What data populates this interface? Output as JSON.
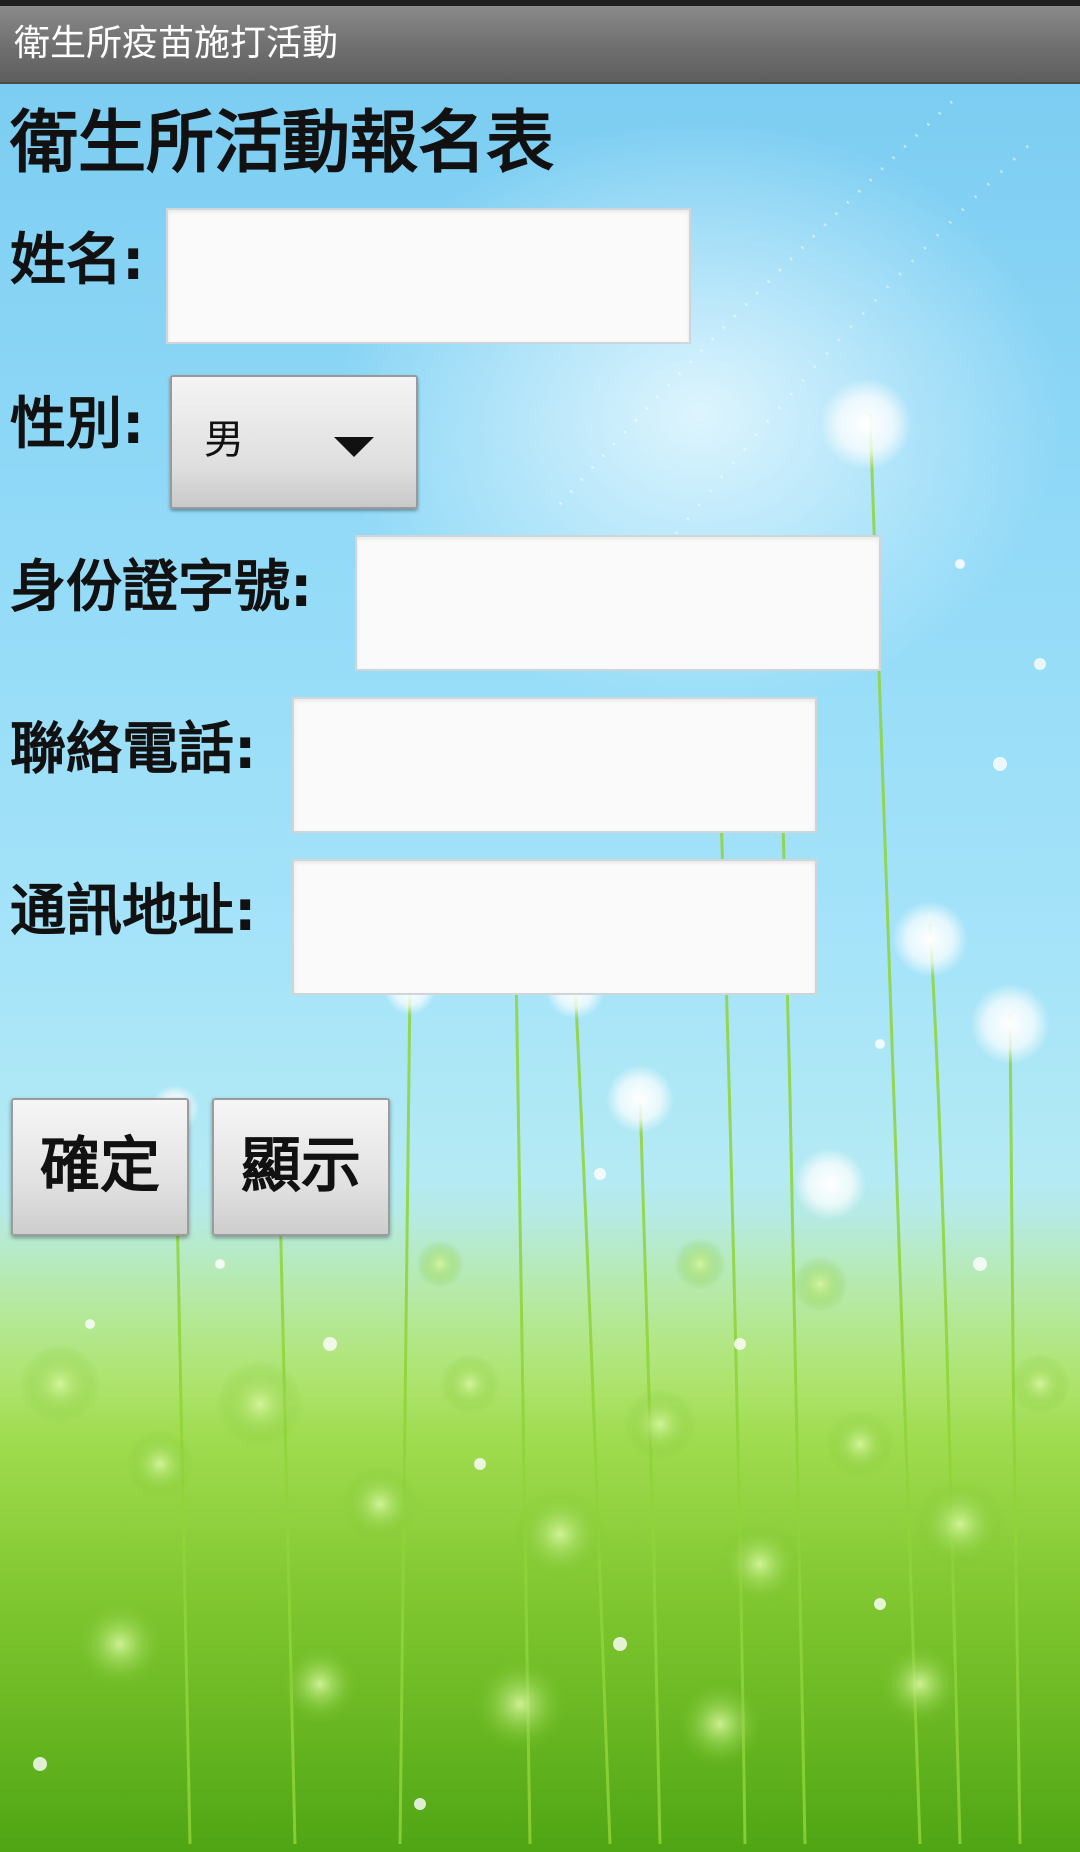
{
  "app_title": "衛生所疫苗施打活動",
  "form": {
    "heading": "衛生所活動報名表",
    "name": {
      "label": "姓名:",
      "value": ""
    },
    "gender": {
      "label": "性別:",
      "selected": "男"
    },
    "id_number": {
      "label": "身份證字號:",
      "value": ""
    },
    "phone": {
      "label": "聯絡電話:",
      "value": ""
    },
    "address": {
      "label": "通訊地址:",
      "value": ""
    }
  },
  "buttons": {
    "confirm": "確定",
    "display": "顯示"
  },
  "colors": {
    "title_bar": "#6f6f6f",
    "sky": "#94dbf8",
    "grass": "#8fd43b"
  },
  "icons": {
    "dropdown": "triangle-down-icon"
  }
}
